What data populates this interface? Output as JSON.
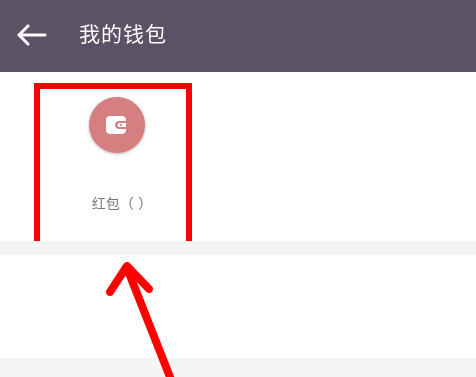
{
  "app_bar": {
    "title": "我的钱包",
    "back_icon": "back-arrow-icon",
    "background_color": "#5b5365"
  },
  "wallet": {
    "item_label": "红包（   ）",
    "item_icon": "wallet-icon",
    "icon_color": "#d67f81"
  },
  "annotation": {
    "highlight_color": "#ff0000"
  }
}
